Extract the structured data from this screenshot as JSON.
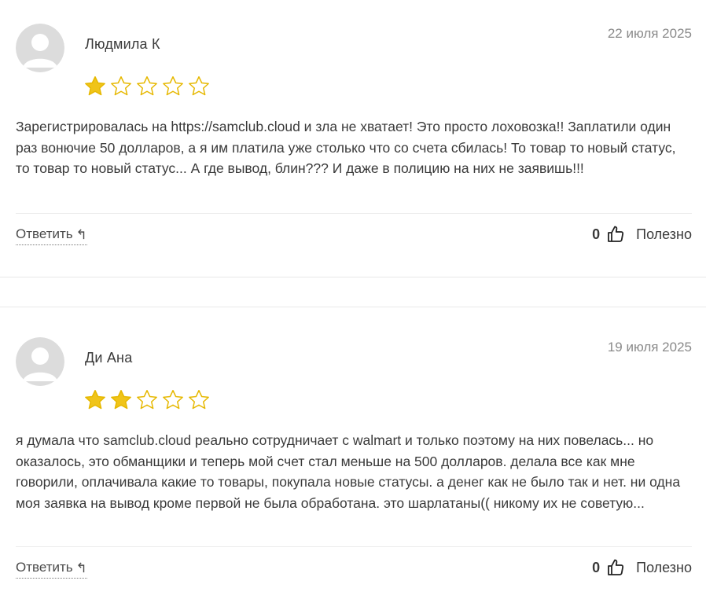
{
  "reviews": [
    {
      "author": "Людмила К",
      "date": "22 июля 2025",
      "rating": 1,
      "max_rating": 5,
      "text": "Зарегистрировалась на https://samclub.cloud и зла не хватает! Это просто лоховозка!! Заплатили один раз вонючие 50 долларов, а я им платила уже столько что со счета сбилась! То товар то новый статус, то товар то новый статус... А где вывод, блин??? И даже в полицию на них не заявишь!!!",
      "reply_label": "Ответить",
      "helpful_count": "0",
      "helpful_label": "Полезно"
    },
    {
      "author": "Ди Ана",
      "date": "19 июля 2025",
      "rating": 2,
      "max_rating": 5,
      "text": "я думала что samclub.cloud реально сотрудничает с walmart и только поэтому на них повелась... но оказалось, это обманщики и теперь мой счет стал меньше на 500 долларов. делала все как мне говорили, оплачивала какие то товары, покупала новые статусы. а денег как не было так и нет. ни одна моя заявка на вывод кроме первой не была обработана. это шарлатаны(( никому их не советую...",
      "reply_label": "Ответить",
      "helpful_count": "0",
      "helpful_label": "Полезно"
    }
  ],
  "colors": {
    "star_filled": "#f0c419",
    "star_outline": "#e6b800",
    "avatar_bg": "#dcdcdc",
    "avatar_fg": "#ffffff"
  },
  "icons": {
    "reply": "reply-arrow-icon",
    "helpful": "thumbs-up-icon",
    "avatar": "user-avatar-icon",
    "star": "star-icon"
  }
}
